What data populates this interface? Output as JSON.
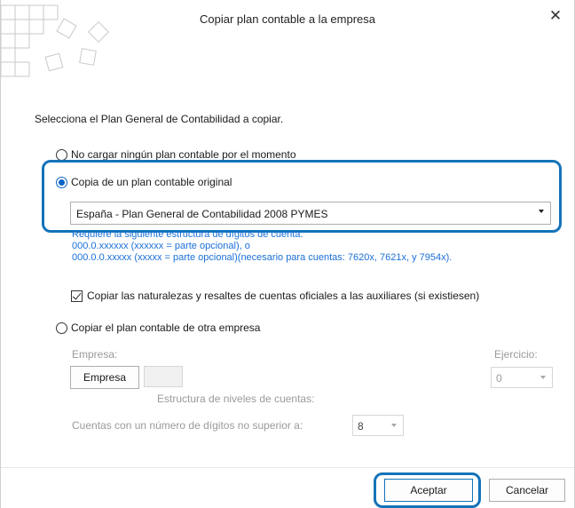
{
  "window": {
    "title": "Copiar plan contable a la empresa",
    "close_icon": "close-icon"
  },
  "prompt": "Selecciona el Plan General de Contabilidad a copiar.",
  "options": {
    "no_cargar": "No cargar ningún plan contable por el momento",
    "copia_original": "Copia de un plan contable original",
    "copiar_otra": "Copiar el plan contable de otra empresa"
  },
  "plan_select": {
    "value": "España - Plan General de Contabilidad 2008 PYMES"
  },
  "info": {
    "line1": "Requiere la siguiente estructura de dígitos de cuenta:",
    "line2": "000.0.xxxxxx (xxxxxx = parte opcional), o",
    "line3": "000.0.0.xxxxx (xxxxx = parte opcional)(necesario para cuentas: 7620x, 7621x, y 7954x)."
  },
  "checkbox": {
    "label": "Copiar las naturalezas y resaltes de cuentas oficiales a las auxiliares (si existiesen)",
    "checked": true
  },
  "otra_empresa": {
    "empresa_label": "Empresa:",
    "empresa_button": "Empresa",
    "ejercicio_label": "Ejercicio:",
    "ejercicio_value": "0",
    "estructura_label": "Estructura de niveles de cuentas:",
    "cuentas_label": "Cuentas con un número de dígitos no superior a:",
    "digitos_value": "8"
  },
  "buttons": {
    "aceptar": "Aceptar",
    "cancelar": "Cancelar"
  },
  "colors": {
    "accent": "#1473b9",
    "info_text": "#1a6fd6",
    "disabled_text": "#9a9a9a"
  }
}
